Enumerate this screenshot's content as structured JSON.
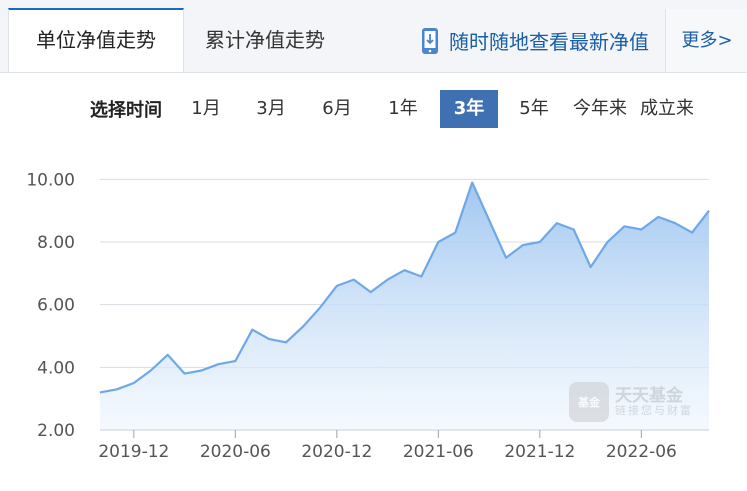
{
  "tabs": [
    {
      "label": "单位净值走势",
      "active": true
    },
    {
      "label": "累计净值走势",
      "active": false
    }
  ],
  "promo": {
    "text": "随时随地查看最新净值",
    "icon": "phone-download-icon"
  },
  "more": {
    "label": "更多>"
  },
  "range": {
    "label": "选择时间",
    "options": [
      "1月",
      "3月",
      "6月",
      "1年",
      "3年",
      "5年",
      "今年来",
      "成立来"
    ],
    "selected": "3年"
  },
  "watermark": {
    "badge": "基金",
    "main": "天天基金",
    "sub": "链接您与财富"
  },
  "colors": {
    "accent": "#3f71b2",
    "line": "#6fa8e6",
    "fill_top": "#9cc4f0",
    "fill_bottom": "#eef5fd",
    "grid": "#d8dde3"
  },
  "chart_data": {
    "type": "area",
    "title": "",
    "xlabel": "",
    "ylabel": "",
    "ylim": [
      2.0,
      11.0
    ],
    "yticks": [
      "2.00",
      "4.00",
      "6.00",
      "8.00",
      "10.00"
    ],
    "xticks": [
      "2019-12",
      "2020-06",
      "2020-12",
      "2021-06",
      "2021-12",
      "2022-06"
    ],
    "grid": true,
    "series": [
      {
        "x": [
          "2019-10",
          "2019-11",
          "2019-12",
          "2020-01",
          "2020-02",
          "2020-03",
          "2020-04",
          "2020-05",
          "2020-06",
          "2020-07",
          "2020-08",
          "2020-09",
          "2020-10",
          "2020-11",
          "2020-12",
          "2021-01",
          "2021-02",
          "2021-03",
          "2021-04",
          "2021-05",
          "2021-06",
          "2021-07",
          "2021-08",
          "2021-09",
          "2021-10",
          "2021-11",
          "2021-12",
          "2022-01",
          "2022-02",
          "2022-03",
          "2022-04",
          "2022-05",
          "2022-06",
          "2022-07",
          "2022-08",
          "2022-09",
          "2022-10"
        ],
        "values": [
          3.2,
          3.3,
          3.5,
          3.9,
          4.4,
          3.8,
          3.9,
          4.1,
          4.2,
          5.2,
          4.9,
          4.8,
          5.3,
          5.9,
          6.6,
          6.8,
          6.4,
          6.8,
          7.1,
          6.9,
          8.0,
          8.3,
          9.9,
          8.7,
          7.5,
          7.9,
          8.0,
          8.6,
          8.4,
          7.2,
          8.0,
          8.5,
          8.4,
          8.8,
          8.6,
          8.3,
          9.0
        ]
      }
    ]
  }
}
